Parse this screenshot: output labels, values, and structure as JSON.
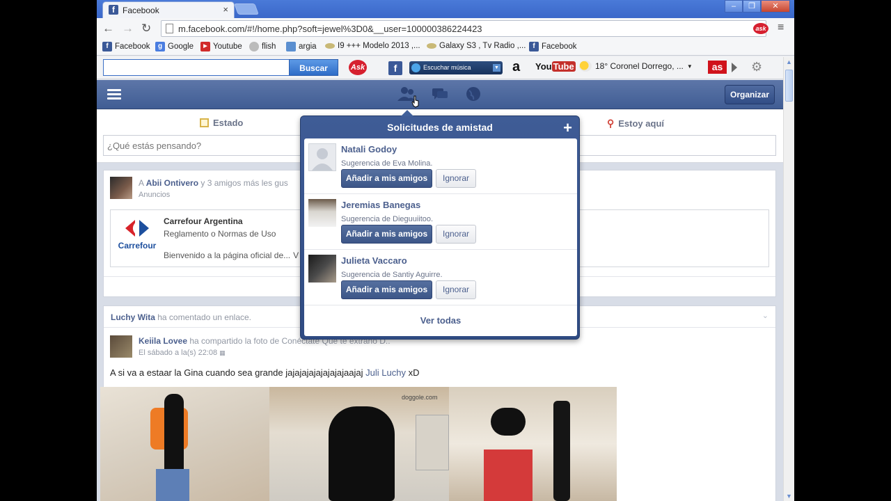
{
  "browser": {
    "tab_title": "Facebook",
    "url": "m.facebook.com/#!/home.php?soft=jewel%3D0&__user=100000386224423",
    "bookmarks": [
      "Facebook",
      "Google",
      "Youtube",
      "flish",
      "argia",
      "I9 +++ Modelo 2013 ,...",
      "Galaxy S3 , Tv Radio ,...",
      "Facebook"
    ],
    "close_glyph": "×",
    "star_glyph": "☆"
  },
  "ask_toolbar": {
    "search_value": "",
    "search_button": "Buscar",
    "ask_logo": "Ask",
    "radio_label": "Escuchar música",
    "amazon": "a",
    "youtube_you": "You",
    "youtube_tube": "Tube",
    "weather": "18° Coronel Dorrego, ...",
    "as_logo": "as"
  },
  "fb_header": {
    "organize_button": "Organizar"
  },
  "composer": {
    "tab_status": "Estado",
    "tab_checkin": "Estoy aquí",
    "placeholder": "¿Qué estás pensando?"
  },
  "feed": {
    "ad_story": {
      "actor": "Abii Ontivero",
      "prefix": "A ",
      "text": " y 3 amigos más les gus",
      "sublabel": "Anuncios",
      "page_name": "Carrefour Argentina",
      "line1": "Reglamento o Normas de Uso",
      "line2": "Bienvenido a la página oficial de...",
      "truncated_tail": "V",
      "logo_text": "Carrefour"
    },
    "story2": {
      "header_actor": "Luchy Wita",
      "header_text": " ha comentado un enlace.",
      "actor": "Keiila Lovee",
      "action": " ha compartido la foto de Conéctate Que te extraño D..",
      "time": "El sábado a la(s) 22:08",
      "message": "A si va a estaar la Gina cuando sea grande jajajajajajajajajaajaj ",
      "mention": "Juli Luchy",
      "message_end": " xD",
      "watermark": "doggole.com"
    }
  },
  "popover": {
    "title": "Solicitudes de amistad",
    "plus": "+",
    "requests": [
      {
        "name": "Natali Godoy",
        "suggestion": "Sugerencia de Eva Molina.",
        "add": "Añadir a mis amigos",
        "ignore": "Ignorar"
      },
      {
        "name": "Jeremias Banegas",
        "suggestion": "Sugerencia de Dieguuiitoo.",
        "add": "Añadir a mis amigos",
        "ignore": "Ignorar"
      },
      {
        "name": "Julieta Vaccaro",
        "suggestion": "Sugerencia de Santiy Aguirre.",
        "add": "Añadir a mis amigos",
        "ignore": "Ignorar"
      }
    ],
    "see_all": "Ver todas"
  },
  "colors": {
    "fb_blue": "#3b5998",
    "fb_header": "#4b67a1",
    "link": "#4b5f8d"
  }
}
